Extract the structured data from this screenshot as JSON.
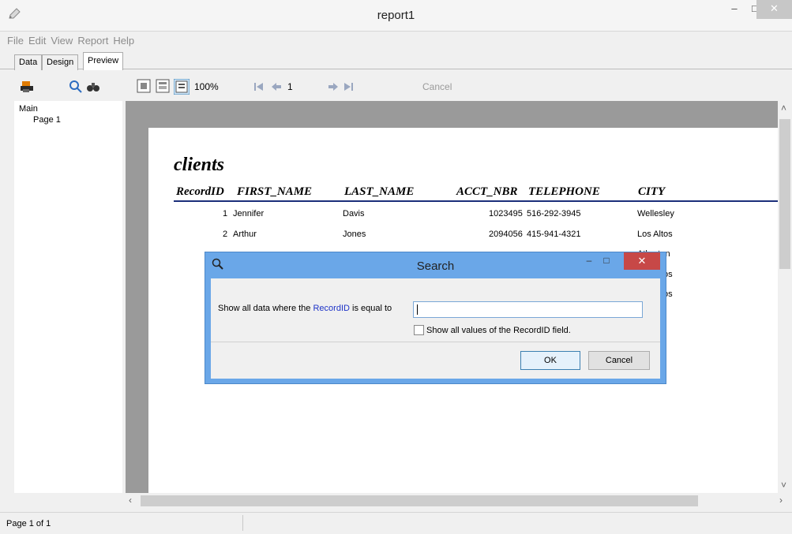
{
  "window": {
    "title": "report1",
    "minimize": "–",
    "maximize": "□",
    "close": "✕"
  },
  "menu": [
    "File",
    "Edit",
    "View",
    "Report",
    "Help"
  ],
  "tabs": [
    "Data",
    "Design",
    "Preview"
  ],
  "active_tab": "Preview",
  "toolbar": {
    "zoom": "100%",
    "page_number": "1",
    "cancel_label": "Cancel"
  },
  "tree": {
    "root": "Main",
    "child": "Page 1"
  },
  "report": {
    "title": "clients",
    "columns": [
      "RecordID",
      "FIRST_NAME",
      "LAST_NAME",
      "ACCT_NBR",
      "TELEPHONE",
      "CITY"
    ],
    "rows": [
      [
        "1",
        "Jennifer",
        "Davis",
        "1023495",
        "516-292-3945",
        "Wellesley"
      ],
      [
        "2",
        "Arthur",
        "Jones",
        "2094056",
        "415-941-4321",
        "Los Altos"
      ]
    ],
    "partial_cells": {
      "row3_city": "Atherton",
      "row4_city": "os",
      "row5_city": "os"
    }
  },
  "status": {
    "page": "Page 1 of 1"
  },
  "dialog": {
    "title": "Search",
    "prefix": "Show all data where the",
    "field": "RecordID",
    "suffix": "is equal to",
    "input_value": "",
    "checkbox_label": "Show all values of the RecordID field.",
    "ok_label": "OK",
    "cancel_label": "Cancel"
  },
  "colors": {
    "dialog_frame": "#6aa7e8",
    "close_red": "#c74847",
    "field_blue": "#1d33c7",
    "header_rule": "#1b2f7a"
  }
}
